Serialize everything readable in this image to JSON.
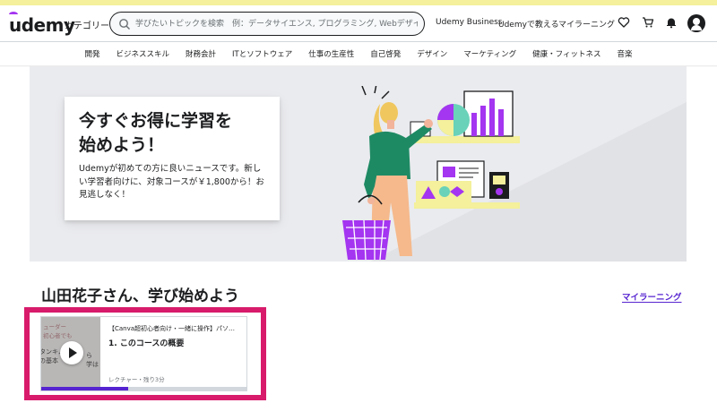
{
  "header": {
    "logo": "udemy",
    "categories_label": "カテゴリー",
    "search_placeholder": "学びたいトピックを検索　例：データサイエンス, プログラミング, Webデザイン",
    "business_link": "Udemy Business",
    "teach_link": "Udemyで教える",
    "my_learning_link": "マイラーニング",
    "icons": [
      "heart-icon",
      "cart-icon",
      "bell-icon",
      "user-avatar-icon"
    ]
  },
  "category_nav": [
    "開発",
    "ビジネススキル",
    "財務会計",
    "ITとソフトウェア",
    "仕事の生産性",
    "自己啓発",
    "デザイン",
    "マーケティング",
    "健康・フィットネス",
    "音楽"
  ],
  "hero": {
    "title_line1": "今すぐお得に学習を",
    "title_line2": "始めよう！",
    "text": "Udemyが初めての方に良いニュースです。新しい学習者向けに、対象コースが￥1,800から！お見逃しなく！"
  },
  "welcome": {
    "heading": "山田花子さん、学び始めよう",
    "my_learning_link": "マイラーニング"
  },
  "course_card": {
    "course_title": "【Canva超初心者向け・一緒に操作】パソ…",
    "lesson_title": "1. このコースの概要",
    "meta": "レクチャー・残り3分",
    "thumb_line1": "ューダー",
    "thumb_line2": "初心者でも",
    "thumb_line3": "タンキム",
    "thumb_line4": "ら",
    "thumb_line5": "の基本",
    "thumb_line6": "学は",
    "progress": 0.42
  },
  "colors": {
    "brand_purple": "#a435f0",
    "link_purple": "#5624d0",
    "highlight_pink": "#d81b6b",
    "top_strip": "#f4f09b"
  }
}
